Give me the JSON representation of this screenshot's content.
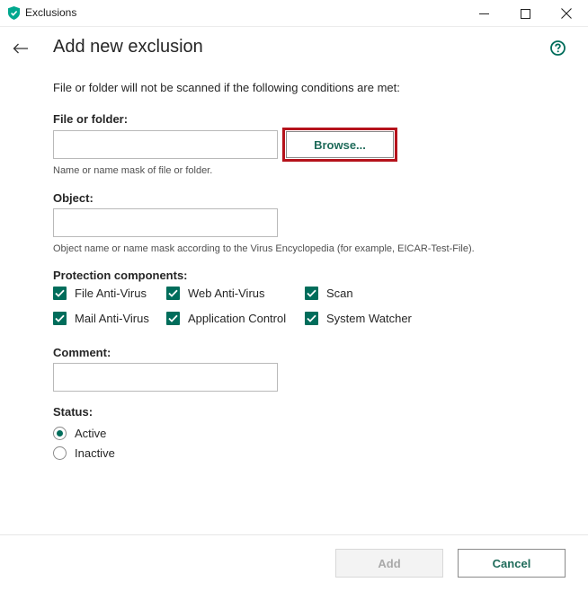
{
  "window": {
    "title": "Exclusions",
    "app_icon": "kaspersky-shield-icon",
    "controls": [
      "minimize-icon",
      "maximize-icon",
      "close-icon"
    ]
  },
  "header": {
    "back_icon": "arrow-left-icon",
    "title": "Add new exclusion",
    "help_icon": "question-circle-icon"
  },
  "form": {
    "intro": "File or folder will not be scanned if the following conditions are met:",
    "file_or_folder": {
      "label": "File or folder:",
      "value": "",
      "hint": "Name or name mask of file or folder.",
      "browse_label": "Browse..."
    },
    "object": {
      "label": "Object:",
      "value": "",
      "hint": "Object name or name mask according to the Virus Encyclopedia (for example, EICAR-Test-File)."
    },
    "protection_components": {
      "label": "Protection components:",
      "items": [
        {
          "label": "File Anti-Virus",
          "checked": true
        },
        {
          "label": "Web Anti-Virus",
          "checked": true
        },
        {
          "label": "Scan",
          "checked": true
        },
        {
          "label": "Mail Anti-Virus",
          "checked": true
        },
        {
          "label": "Application Control",
          "checked": true
        },
        {
          "label": "System Watcher",
          "checked": true
        }
      ]
    },
    "comment": {
      "label": "Comment:",
      "value": ""
    },
    "status": {
      "label": "Status:",
      "options": [
        {
          "label": "Active",
          "selected": true
        },
        {
          "label": "Inactive",
          "selected": false
        }
      ]
    }
  },
  "footer": {
    "add_label": "Add",
    "add_enabled": false,
    "cancel_label": "Cancel"
  },
  "colors": {
    "accent": "#006d5b",
    "link_text": "#1f6b5a",
    "highlight": "#b5121b",
    "disabled_text": "#a9a9a9"
  }
}
